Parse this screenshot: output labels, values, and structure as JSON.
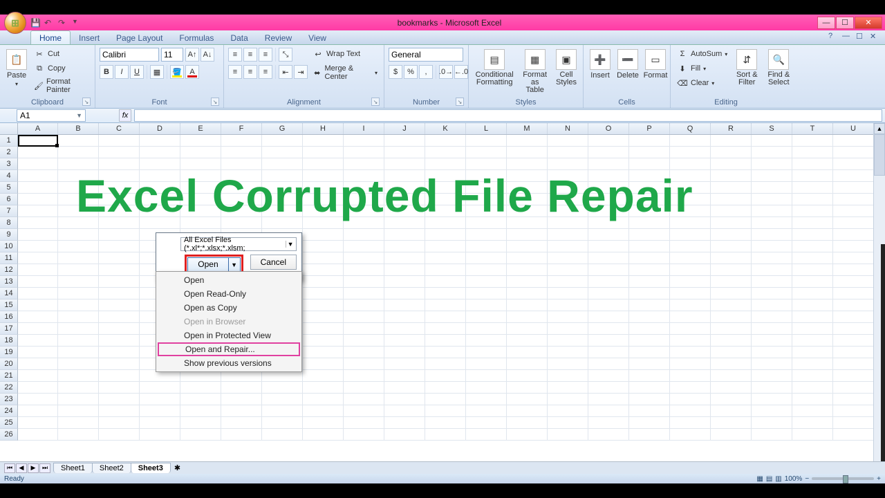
{
  "title": "bookmarks - Microsoft Excel",
  "qat_icons": [
    "save",
    "undo",
    "redo"
  ],
  "tabs": [
    "Home",
    "Insert",
    "Page Layout",
    "Formulas",
    "Data",
    "Review",
    "View"
  ],
  "active_tab": "Home",
  "clipboard": {
    "paste": "Paste",
    "cut": "Cut",
    "copy": "Copy",
    "painter": "Format Painter",
    "label": "Clipboard"
  },
  "font": {
    "name": "Calibri",
    "size": "11",
    "label": "Font"
  },
  "font_buttons": {
    "bold": "B",
    "italic": "I",
    "underline": "U"
  },
  "alignment": {
    "wrap": "Wrap Text",
    "merge": "Merge & Center",
    "label": "Alignment"
  },
  "number": {
    "format": "General",
    "label": "Number"
  },
  "styles": {
    "cond": "Conditional Formatting",
    "table": "Format as Table",
    "cell": "Cell Styles",
    "label": "Styles"
  },
  "cells": {
    "insert": "Insert",
    "delete": "Delete",
    "format": "Format",
    "label": "Cells"
  },
  "editing": {
    "sum": "AutoSum",
    "fill": "Fill",
    "clear": "Clear",
    "sort": "Sort & Filter",
    "find": "Find & Select",
    "label": "Editing"
  },
  "namebox": "A1",
  "columns": [
    "A",
    "B",
    "C",
    "D",
    "E",
    "F",
    "G",
    "H",
    "I",
    "J",
    "K",
    "L",
    "M",
    "N",
    "O",
    "P",
    "Q",
    "R",
    "S",
    "T",
    "U"
  ],
  "row_count": 26,
  "overlay_text": "Excel Corrupted File Repair",
  "dialog": {
    "filetype": "All Excel Files (*.xl*;*.xlsx;*.xlsm;",
    "open": "Open",
    "cancel": "Cancel"
  },
  "menu": {
    "open": "Open",
    "readonly": "Open Read-Only",
    "ascopy": "Open as Copy",
    "browser": "Open in Browser",
    "protected": "Open in Protected View",
    "repair": "Open and Repair...",
    "previous": "Show previous versions"
  },
  "sheets": [
    "Sheet1",
    "Sheet2",
    "Sheet3"
  ],
  "active_sheet": "Sheet3",
  "status": "Ready",
  "zoom": "100%"
}
